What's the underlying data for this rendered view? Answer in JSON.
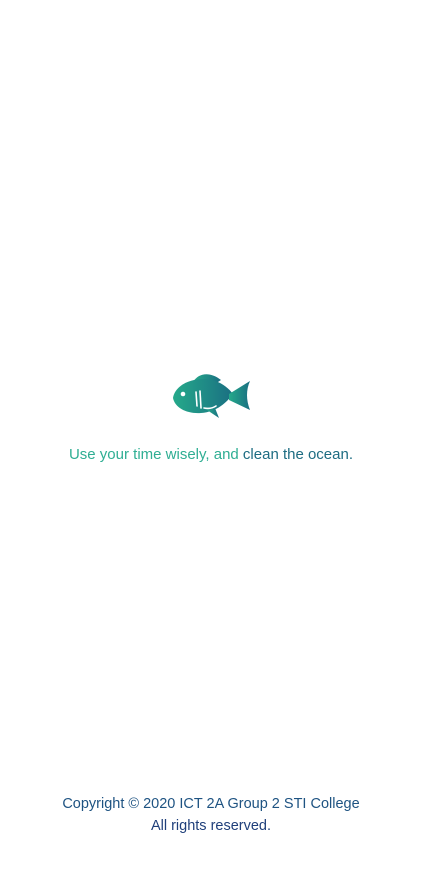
{
  "logo": {
    "icon": "fish-icon",
    "gradient_start": "#25a98a",
    "gradient_end": "#1a6f82"
  },
  "tagline": {
    "part1": "Use your time wisely, and ",
    "part2": "clean the ocean.",
    "color_part1": "#2fae93",
    "color_part2": "#1d6c82"
  },
  "footer": {
    "copyright": "Copyright © 2020 ICT 2A Group 2 STI College",
    "rights": "All rights reserved."
  }
}
